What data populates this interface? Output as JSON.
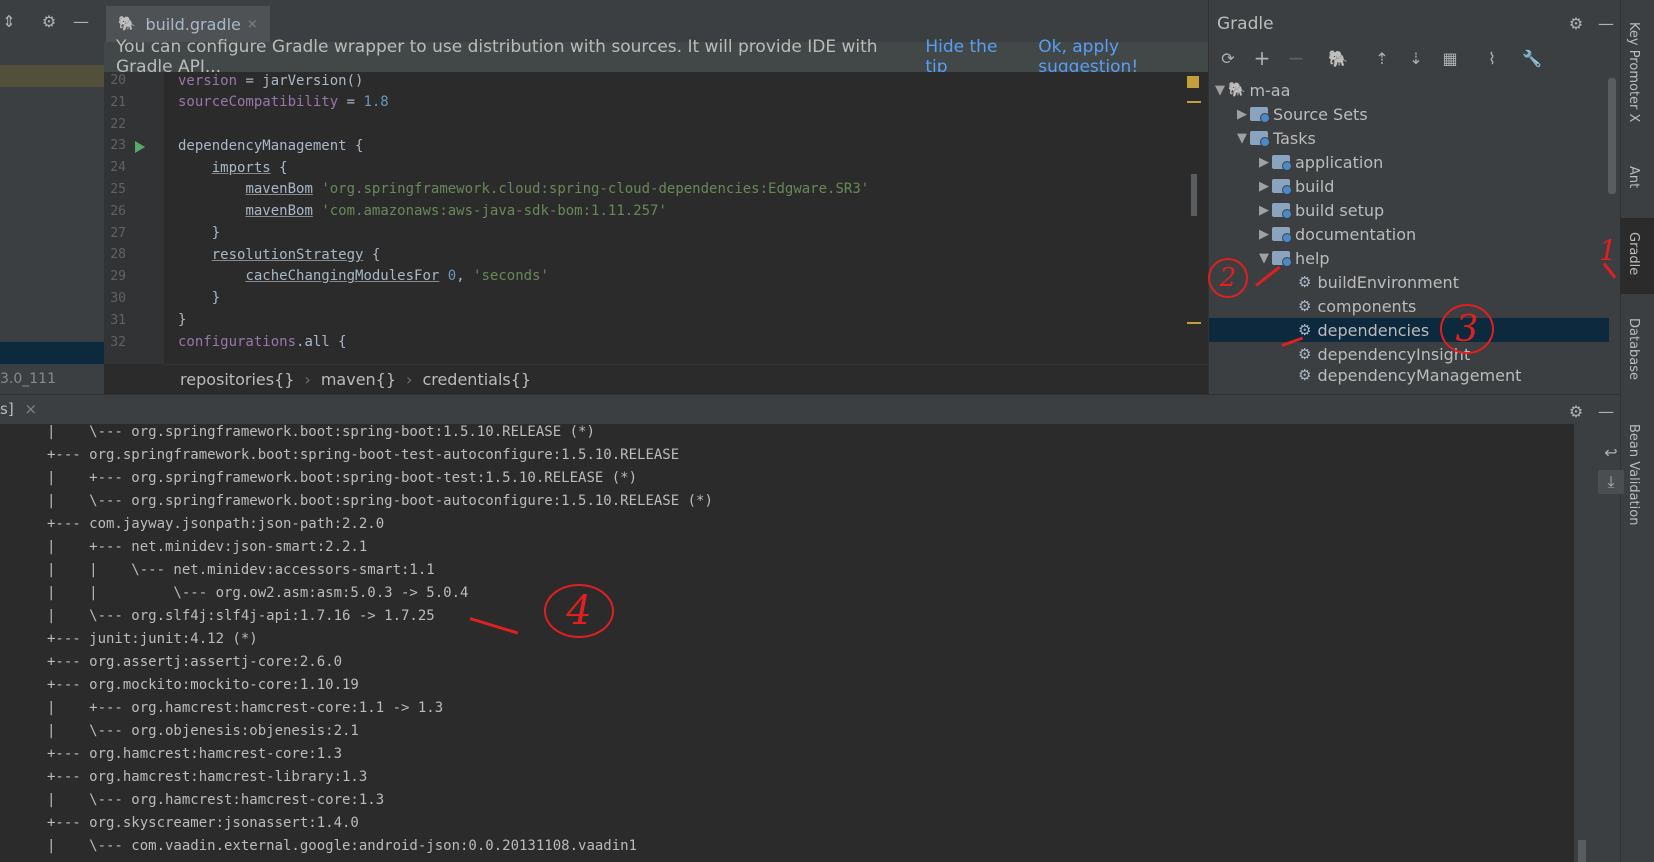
{
  "editor": {
    "tab_label": "build.gradle",
    "tab_close": "×",
    "tip_text": "You can configure Gradle wrapper to use distribution with sources. It will provide IDE with Gradle API...",
    "tip_hide": "Hide the tip",
    "tip_apply": "Ok, apply suggestion!",
    "line_numbers": [
      "20",
      "21",
      "22",
      "23",
      "24",
      "25",
      "26",
      "27",
      "28",
      "29",
      "30",
      "31",
      "32"
    ],
    "breadcrumb": [
      "repositories{}",
      "maven{}",
      "credentials{}"
    ]
  },
  "left": {
    "status_fragment": "3.0_111",
    "run_tab_fragment": "s]",
    "run_tab_close": "×"
  },
  "gradle": {
    "title": "Gradle",
    "root": "m-aa",
    "items": {
      "source_sets": "Source Sets",
      "tasks": "Tasks",
      "application": "application",
      "build": "build",
      "build_setup": "build setup",
      "documentation": "documentation",
      "help": "help",
      "build_environment": "buildEnvironment",
      "components": "components",
      "dependencies": "dependencies",
      "dependency_insight": "dependencyInsight",
      "dependency_management": "dependencyManagement"
    }
  },
  "right_strip": [
    "Key Promoter X",
    "Ant",
    "Gradle",
    "Database",
    "Bean Validation"
  ],
  "console": [
    "|    \\--- org.springframework.boot:spring-boot:1.5.10.RELEASE (*)",
    "+--- org.springframework.boot:spring-boot-test-autoconfigure:1.5.10.RELEASE",
    "|    +--- org.springframework.boot:spring-boot-test:1.5.10.RELEASE (*)",
    "|    \\--- org.springframework.boot:spring-boot-autoconfigure:1.5.10.RELEASE (*)",
    "+--- com.jayway.jsonpath:json-path:2.2.0",
    "|    +--- net.minidev:json-smart:2.2.1",
    "|    |    \\--- net.minidev:accessors-smart:1.1",
    "|    |         \\--- org.ow2.asm:asm:5.0.3 -> 5.0.4",
    "|    \\--- org.slf4j:slf4j-api:1.7.16 -> 1.7.25",
    "+--- junit:junit:4.12 (*)",
    "+--- org.assertj:assertj-core:2.6.0",
    "+--- org.mockito:mockito-core:1.10.19",
    "|    +--- org.hamcrest:hamcrest-core:1.1 -> 1.3",
    "|    \\--- org.objenesis:objenesis:2.1",
    "+--- org.hamcrest:hamcrest-core:1.3",
    "+--- org.hamcrest:hamcrest-library:1.3",
    "|    \\--- org.hamcrest:hamcrest-core:1.3",
    "+--- org.skyscreamer:jsonassert:1.4.0",
    "|    \\--- com.vaadin.external.google:android-json:0.0.20131108.vaadin1"
  ],
  "annotations": [
    "1",
    "2",
    "3",
    "4"
  ]
}
